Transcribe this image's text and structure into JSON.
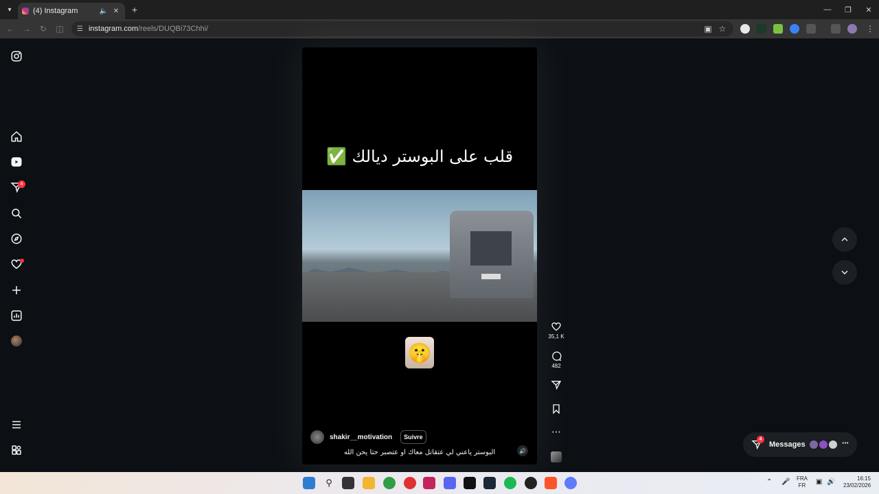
{
  "browser": {
    "tab_title": "(4) Instagram",
    "url_host": "instagram.com",
    "url_path": "/reels/DUQBi73Chhi/"
  },
  "sidebar": {
    "items": [
      "instagram-logo",
      "home",
      "reels",
      "messages",
      "search",
      "explore",
      "notifications",
      "create",
      "dashboard",
      "profile",
      "more",
      "also-from-meta"
    ],
    "messages_badge": "4"
  },
  "reel": {
    "overlay_text": "قلب على البوستر ديالك ✅",
    "emoji": "🤫",
    "username": "shakir__motivation",
    "follow_label": "Suivre",
    "caption": "البوستر ياعني لي عتقاتل معاك او عتصبر حتا يحن الله"
  },
  "actions": {
    "likes": "35,1 K",
    "comments": "482"
  },
  "messages_bar": {
    "label": "Messages",
    "badge": "4"
  },
  "taskbar": {
    "lang_top": "FRA",
    "lang_bottom": "FR",
    "time": "16:15",
    "date": "23/02/2026"
  }
}
